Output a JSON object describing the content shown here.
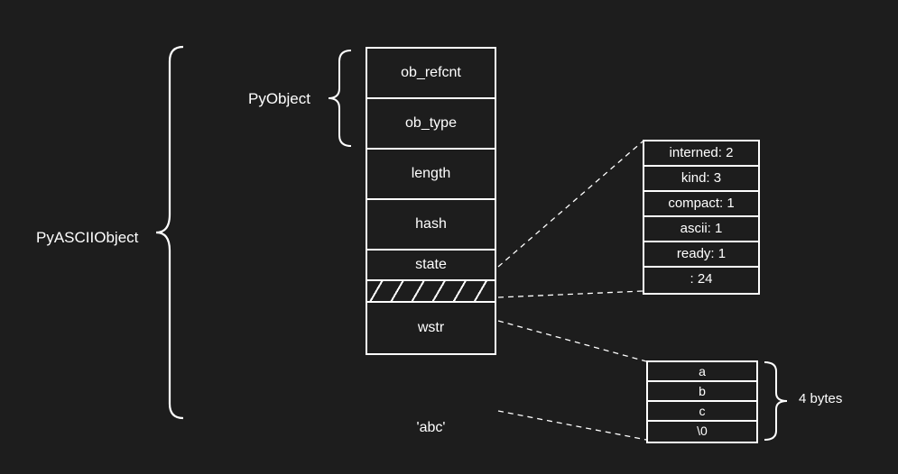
{
  "labels": {
    "pyascii": "PyASCIIObject",
    "pyobject": "PyObject",
    "bytes_note": "4 bytes",
    "caption": "'abc'"
  },
  "struct_fields": {
    "ob_refcnt": "ob_refcnt",
    "ob_type": "ob_type",
    "length": "length",
    "hash": "hash",
    "state": "state",
    "wstr": "wstr"
  },
  "state_detail": {
    "rows": [
      "interned: 2",
      "kind: 3",
      "compact: 1",
      "ascii: 1",
      "ready: 1",
      ": 24"
    ]
  },
  "bytes_detail": {
    "rows": [
      "a",
      "b",
      "c",
      "\\0"
    ]
  }
}
